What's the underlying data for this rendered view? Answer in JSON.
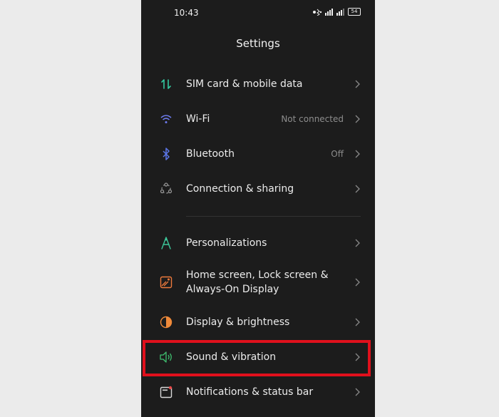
{
  "status_bar": {
    "time": "10:43",
    "battery": "54"
  },
  "header": {
    "title": "Settings"
  },
  "settings": [
    {
      "id": "sim",
      "label": "SIM card & mobile data",
      "value": "",
      "icon": "sim-data-icon",
      "color": "#33c9a0"
    },
    {
      "id": "wifi",
      "label": "Wi-Fi",
      "value": "Not connected",
      "icon": "wifi-icon",
      "color": "#6e7cf0"
    },
    {
      "id": "bluetooth",
      "label": "Bluetooth",
      "value": "Off",
      "icon": "bluetooth-icon",
      "color": "#5b76e8"
    },
    {
      "id": "connection",
      "label": "Connection & sharing",
      "value": "",
      "icon": "connection-sharing-icon",
      "color": "#9a9a9a"
    },
    {
      "id": "personalizations",
      "label": "Personalizations",
      "value": "",
      "icon": "personalizations-icon",
      "color": "#3cc79a"
    },
    {
      "id": "home_screen",
      "label_line1": "Home screen, Lock screen &",
      "label_line2": "Always-On Display",
      "value": "",
      "icon": "home-screen-icon",
      "color": "#ee7a3c"
    },
    {
      "id": "display",
      "label": "Display & brightness",
      "value": "",
      "icon": "display-brightness-icon",
      "color": "#f08a3a"
    },
    {
      "id": "sound",
      "label": "Sound & vibration",
      "value": "",
      "icon": "sound-icon",
      "color": "#3fbf6f"
    },
    {
      "id": "notifications",
      "label": "Notifications & status bar",
      "value": "",
      "icon": "notifications-icon",
      "color": "#e84a4a"
    }
  ],
  "highlight": {
    "color": "#e0101c",
    "target": "Sound & vibration"
  }
}
